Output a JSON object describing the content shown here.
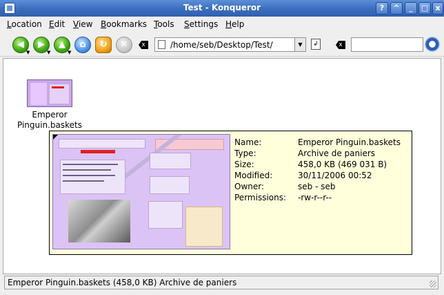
{
  "window": {
    "title": "Test - Konqueror",
    "buttons": [
      "?",
      "^",
      "_",
      "□",
      "x"
    ]
  },
  "menu": [
    {
      "label": "Location",
      "mnemonic": "L",
      "rest": "ocation"
    },
    {
      "label": "Edit",
      "mnemonic": "E",
      "rest": "dit"
    },
    {
      "label": "View",
      "mnemonic": "V",
      "rest": "iew"
    },
    {
      "label": "Bookmarks",
      "mnemonic": "B",
      "rest": "ookmarks"
    },
    {
      "label": "Tools",
      "mnemonic": "T",
      "rest": "ools"
    },
    {
      "label": "Settings",
      "mnemonic": "S",
      "rest": "ettings"
    },
    {
      "label": "Help",
      "mnemonic": "H",
      "rest": "elp"
    }
  ],
  "toolbar": {
    "icons": [
      "back-icon",
      "forward-icon",
      "up-icon",
      "home-icon",
      "reload-icon",
      "stop-icon",
      "clear-location-icon"
    ],
    "address": "/home/seb/Desktop/Test/",
    "search_value": ""
  },
  "file": {
    "name_line1": "Emperor",
    "name_line2": "Pinguin.baskets"
  },
  "tooltip": {
    "rows": [
      {
        "label": "Name:",
        "value": "Emperor Pinguin.baskets"
      },
      {
        "label": "Type:",
        "value": "Archive de paniers"
      },
      {
        "label": "Size:",
        "value": "458,0 KB (469 031 B)"
      },
      {
        "label": "Modified:",
        "value": "30/11/2006 00:52"
      },
      {
        "label": "Owner:",
        "value": "seb - seb"
      },
      {
        "label": "Permissions:",
        "value": "-rw-r--r--"
      }
    ]
  },
  "status": {
    "text": "Emperor Pinguin.baskets (458,0 KB)  Archive de paniers"
  },
  "colors": {
    "titlebar": "#3c6fc0",
    "tooltip_bg": "#ffffdc",
    "preview_bg": "#dcc3f5"
  }
}
